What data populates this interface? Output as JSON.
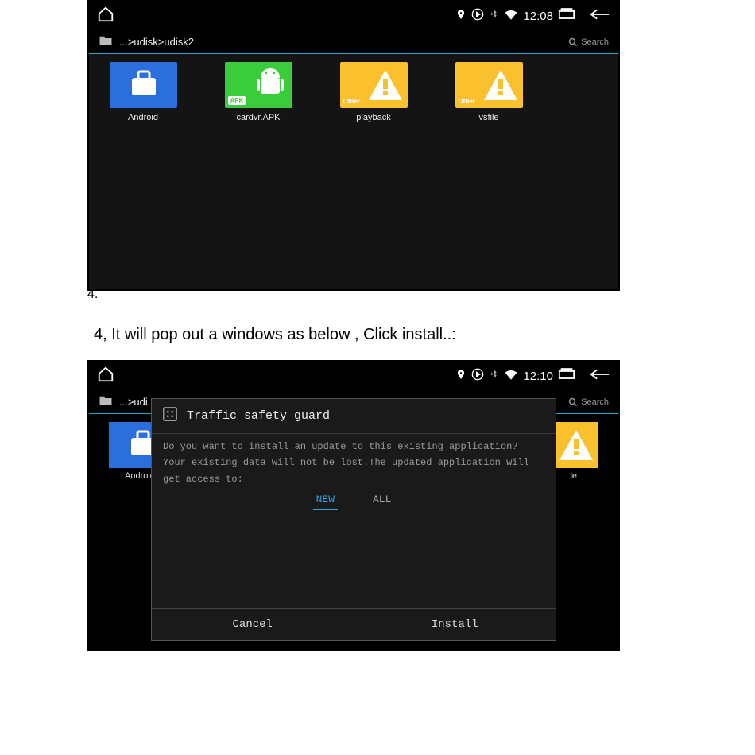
{
  "screen1": {
    "time": "12:08",
    "breadcrumb": "...>udisk>udisk2",
    "search": "Search",
    "tiles": [
      {
        "label": "Android",
        "type": "folder"
      },
      {
        "label": "cardvr.APK",
        "type": "apk",
        "badge": "APK"
      },
      {
        "label": "playback",
        "type": "other",
        "badge": "Other"
      },
      {
        "label": "vsfile",
        "type": "other",
        "badge": "Other"
      }
    ]
  },
  "numLabel": "4.",
  "stepText": "4, It will pop out a windows as below , Click install..:",
  "screen2": {
    "time": "12:10",
    "breadcrumb": "...>udi",
    "search": "Search",
    "bg": {
      "android": "Android",
      "vsfile_suffix": "le"
    },
    "dialog": {
      "title": "Traffic safety guard",
      "body": "Do you want to install an update to this existing application? Your existing data will not be lost.The updated application will get access to:",
      "tabNew": "NEW",
      "tabAll": "ALL",
      "cancel": "Cancel",
      "install": "Install"
    }
  }
}
